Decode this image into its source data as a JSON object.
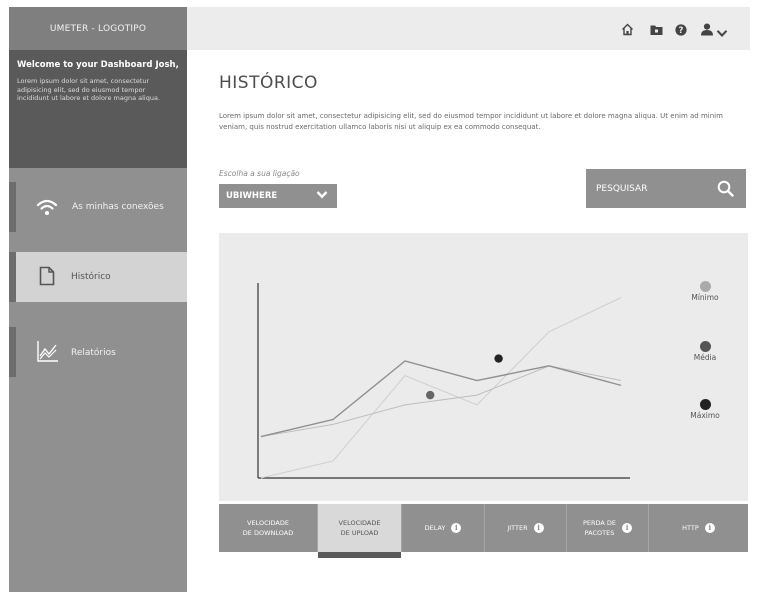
{
  "app": {
    "logo": "UMETER - LOGOTIPO"
  },
  "welcome": {
    "title": "Welcome to your Dashboard Josh,",
    "text": "Lorem ipsum dolor sit amet, consectetur adipisicing elit, sed do eiusmod tempor incididunt ut labore et dolore magna aliqua."
  },
  "sidebar": {
    "items": [
      {
        "label": "As minhas conexões",
        "icon": "wifi-icon"
      },
      {
        "label": "Histórico",
        "icon": "document-icon"
      },
      {
        "label": "Relatórios",
        "icon": "line-chart-icon"
      }
    ]
  },
  "topbar": {
    "icons": [
      "home-icon",
      "folder-icon",
      "help-icon",
      "user-icon",
      "chevron-down-icon"
    ]
  },
  "main": {
    "title": "HISTÓRICO",
    "intro": "Lorem ipsum dolor sit amet, consectetur adipisicing elit, sed do eiusmod tempor incididunt ut labore et dolore magna aliqua. Ut enim ad minim veniam, quis nostrud exercitation ullamco laboris nisi ut aliquip ex ea commodo consequat.",
    "select_label": "Escolha a sua ligação",
    "select_value": "UBIWHERE",
    "search_label": "PESQUISAR"
  },
  "legend": [
    {
      "label": "Mínimo",
      "color": "#aaaaaa"
    },
    {
      "label": "Média",
      "color": "#555555"
    },
    {
      "label": "Máximo",
      "color": "#222222"
    }
  ],
  "tabs": [
    {
      "line1": "VELOCIDADE",
      "line2": "DE DOWNLOAD",
      "info": false
    },
    {
      "line1": "VELOCIDADE",
      "line2": "DE UPLOAD",
      "info": false,
      "active": true
    },
    {
      "line1": "DELAY",
      "line2": "",
      "info": true
    },
    {
      "line1": "JITTER",
      "line2": "",
      "info": true
    },
    {
      "line1": "PERDA DE",
      "line2": "PACOTES",
      "info": true
    },
    {
      "line1": "HTTP",
      "line2": "",
      "info": true
    }
  ],
  "colors": {
    "sidebar": "#909090",
    "welcome_bg": "#5a5a5a",
    "active_item": "#d3d3d3",
    "chart_bg": "#ebebeb"
  },
  "chart_data": {
    "type": "line",
    "x": [
      0,
      1,
      2,
      3,
      4,
      5
    ],
    "series": [
      {
        "name": "Mínimo",
        "values": [
          0,
          0.35,
          2.1,
          1.5,
          3.0,
          3.7
        ]
      },
      {
        "name": "Média",
        "values": [
          0.85,
          1.1,
          1.5,
          1.7,
          2.3,
          2.0
        ]
      },
      {
        "name": "Máximo",
        "values": [
          0.85,
          1.2,
          2.4,
          2.0,
          2.3,
          1.9
        ]
      }
    ],
    "highlights": [
      {
        "series": "Média",
        "x": 2.35,
        "y": 1.7
      },
      {
        "series": "Máximo",
        "x": 3.3,
        "y": 2.45
      }
    ],
    "ylim": [
      0,
      4
    ],
    "xlim": [
      0,
      5
    ],
    "grid": false,
    "legend": "right"
  }
}
